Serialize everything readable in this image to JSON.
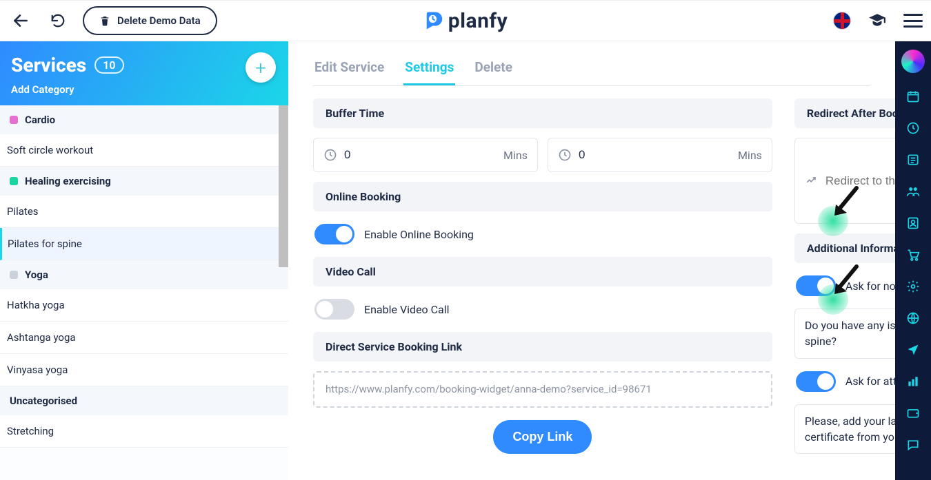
{
  "topbar": {
    "delete_demo_label": "Delete Demo Data",
    "brand": "planfy"
  },
  "sidebar": {
    "title": "Services",
    "count": "10",
    "add_category": "Add Category",
    "categories": [
      {
        "name": "Cardio",
        "color": "#e66fd2",
        "items": [
          "Soft circle workout"
        ]
      },
      {
        "name": "Healing exercising",
        "color": "#1bd6a3",
        "items": [
          "Pilates",
          "Pilates for spine"
        ]
      },
      {
        "name": "Yoga",
        "color": "#cbd2db",
        "items": [
          "Hatkha yoga",
          "Ashtanga yoga",
          "Vinyasa yoga"
        ]
      },
      {
        "name": "Uncategorised",
        "color": null,
        "items": [
          "Stretching"
        ]
      }
    ]
  },
  "tabs": {
    "edit": "Edit Service",
    "settings": "Settings",
    "delete": "Delete"
  },
  "left_col": {
    "buffer_title": "Buffer Time",
    "buffer_before": "0",
    "buffer_after": "0",
    "mins": "Mins",
    "online_title": "Online Booking",
    "online_label": "Enable Online Booking",
    "video_title": "Video Call",
    "video_label": "Enable Video Call",
    "link_title": "Direct Service Booking Link",
    "link_value": "https://www.planfy.com/booking-widget/anna-demo?service_id=98671",
    "copy_label": "Copy Link"
  },
  "right_col": {
    "redirect_title": "Redirect After Booking",
    "redirect_placeholder": "Redirect to this link",
    "addl_title": "Additional Information",
    "ask_notes_label": "Ask for notes",
    "notes_value": "Do you have any issues with your spine?",
    "ask_attach_label": "Ask for attachments",
    "attach_value": "Please, add your latest medical certificate from your therapist."
  }
}
